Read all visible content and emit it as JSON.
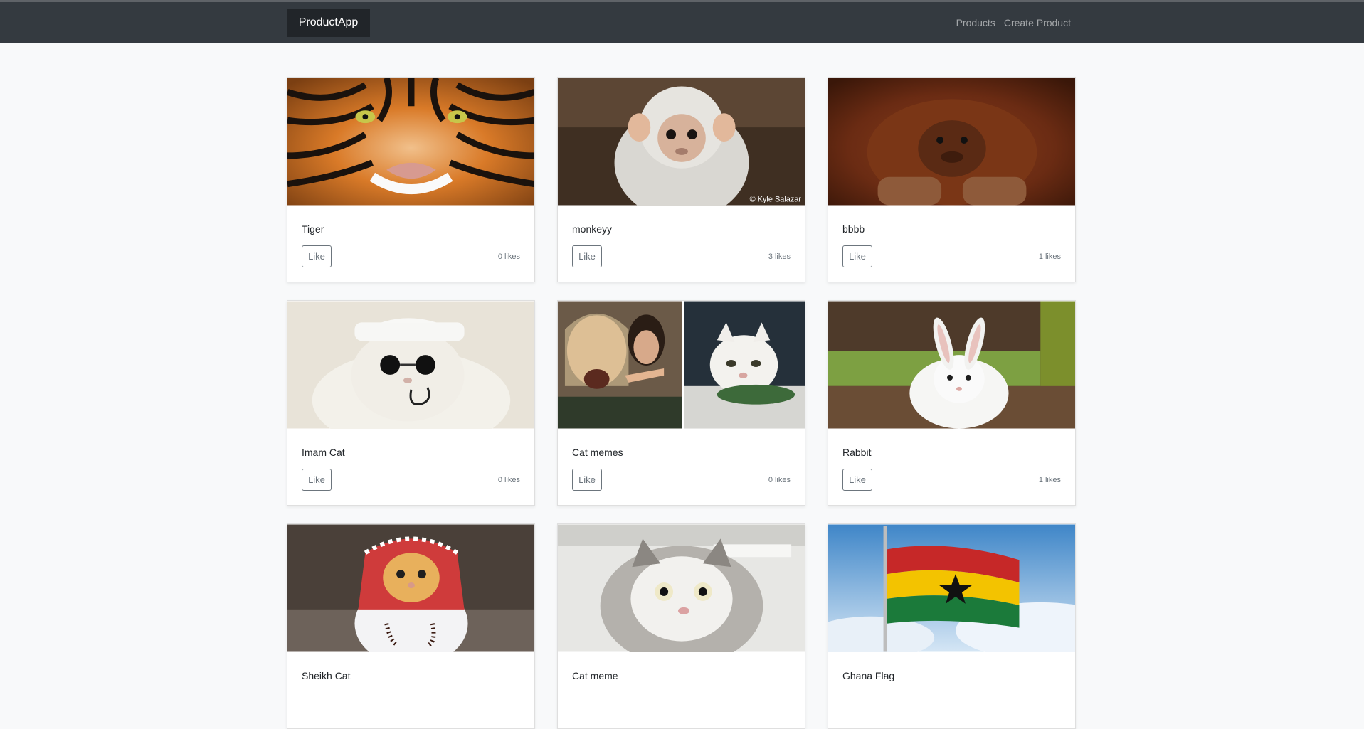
{
  "app": {
    "brand": "ProductApp",
    "nav": [
      "Products",
      "Create Product"
    ]
  },
  "products": [
    {
      "title": "Tiger",
      "like_label": "Like",
      "likes": "0 likes",
      "image": "tiger-photo"
    },
    {
      "title": "monkeyy",
      "like_label": "Like",
      "likes": "3 likes",
      "image": "monkey-photo",
      "image_caption": "© Kyle Salazar"
    },
    {
      "title": "bbbb",
      "like_label": "Like",
      "likes": "1 likes",
      "image": "orangutan-photo"
    },
    {
      "title": "Imam Cat",
      "like_label": "Like",
      "likes": "0 likes",
      "image": "cat-with-cap-and-sunglasses-photo"
    },
    {
      "title": "Cat memes",
      "like_label": "Like",
      "likes": "0 likes",
      "image": "woman-yelling-at-cat-meme"
    },
    {
      "title": "Rabbit",
      "like_label": "Like",
      "likes": "1 likes",
      "image": "white-rabbit-photo"
    },
    {
      "title": "Sheikh Cat",
      "image": "cat-in-keffiyeh-photo"
    },
    {
      "title": "Cat meme",
      "image": "cat-selfie-meme"
    },
    {
      "title": "Ghana Flag",
      "image": "ghana-flag-photo"
    }
  ],
  "colors": {
    "navbar": "#343a40",
    "brand_bg": "#212529",
    "page_bg": "#f8f9fa",
    "button_border": "#6c757d"
  }
}
